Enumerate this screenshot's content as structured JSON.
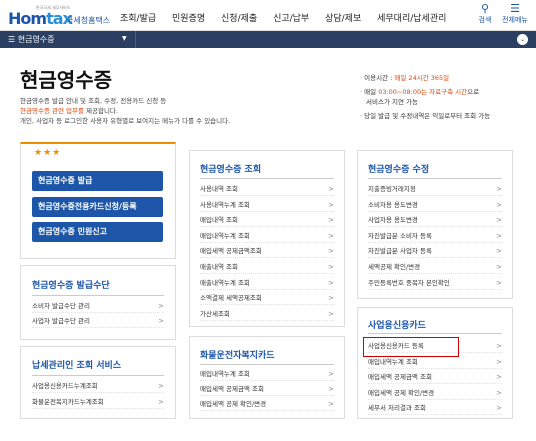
{
  "header": {
    "logo_text_main": "Hom",
    "logo_text_tax": "tax",
    "logo_text_kr": "국세청홈택스",
    "logo_tag": "한국국세 세무서비스",
    "nav": [
      "조회/발급",
      "민원증명",
      "신청/제출",
      "신고/납부",
      "상담/제보",
      "세무대리/납세관리"
    ],
    "search_label": "검색",
    "allmenu_label": "전체메뉴",
    "search_icon": "search-icon",
    "menu_icon": "hamburger-icon"
  },
  "menubar": {
    "selected": "현금영수증"
  },
  "page": {
    "title": "현금영수증",
    "desc1": "현금영수증 발급 안내 및 조회, 수정, 전용카드 신청 등",
    "desc2_hl": "현금영수증 관련 업무를",
    "desc2_rest": " 제공합니다.",
    "desc3": "개인, 사업자 등 로그인한 사용자 유형별로 보여지는 메뉴가 다를 수 있습니다."
  },
  "notice": {
    "line1_label": "이용시간 : ",
    "line1_value": "매일 24시간 365일",
    "line2_label": "매일 ",
    "line2_value": "03:00~08:00는 자료구축 시간",
    "line2_rest": "으로",
    "line3": "서비스가 지연 가능",
    "line4": "당일 발급 및 수정내역은 익일로부터 조회 가능"
  },
  "featured": {
    "stars": "★★★",
    "buttons": [
      "현금영수증 발급",
      "현금영수증전용카드신청/등록",
      "현금영수증 민원신고"
    ]
  },
  "boxes": {
    "issue_means": {
      "title": "현금영수증 발급수단",
      "items": [
        "소비자 발급수단 관리",
        "사업자 발급수단 관리"
      ]
    },
    "taxpayer": {
      "title": "납세관리인 조회 서비스",
      "items": [
        "사업용신용카드누계조회",
        "화물운전복지카드누계조회"
      ]
    },
    "inquiry": {
      "title": "현금영수증 조회",
      "items": [
        "사용내역 조회",
        "사용내역누계 조회",
        "매입내역 조회",
        "매입내역누계 조회",
        "매입세액 공제금액조회",
        "매출내역 조회",
        "매출내역누계 조회",
        "소액결제 세액공제조회",
        "가산세조회"
      ]
    },
    "cargo": {
      "title": "화물운전자복지카드",
      "items": [
        "매입내역누계 조회",
        "매입세액 공제금액 조회",
        "매입세액 공제 확인/변경"
      ]
    },
    "modify": {
      "title": "현금영수증 수정",
      "items": [
        "지출증빙거래지정",
        "소비자용 용도변경",
        "사업자용 용도변경",
        "자진발급분 소비자 등록",
        "자진발급분 사업자 등록",
        "세액공제 확인/변경",
        "주민등록번호 중복자 본인확인"
      ]
    },
    "bizcard": {
      "title": "사업용신용카드",
      "items": [
        "사업용신용카드 등록",
        "매입내역누계 조회",
        "매입세액 공제금액 조회",
        "매입세액 공제 확인/변경",
        "세무서 처리결과 조회"
      ]
    }
  }
}
